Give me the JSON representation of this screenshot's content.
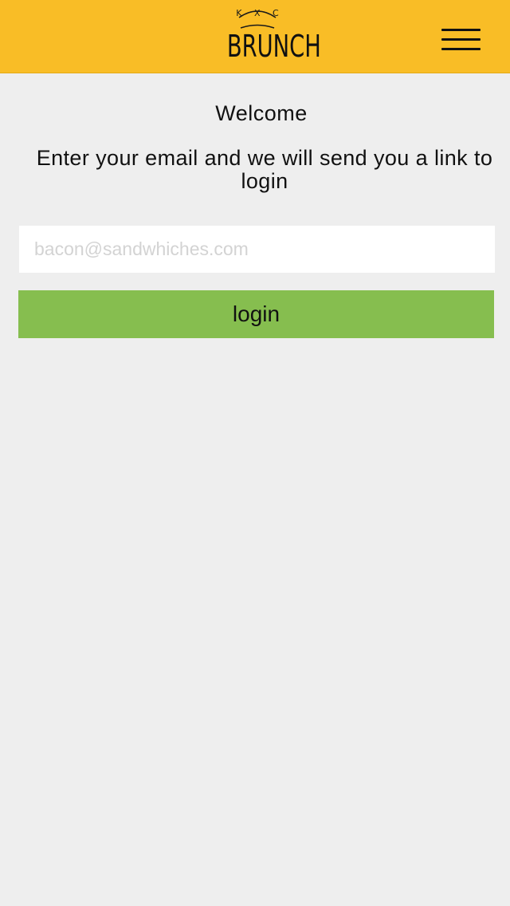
{
  "header": {
    "logo": {
      "top_text": "K X C",
      "main_text": "BRUNCH"
    },
    "menu_icon": "hamburger-menu-icon"
  },
  "main": {
    "welcome": "Welcome",
    "instructions": "Enter your email and we will send you a link to login",
    "email_placeholder": "bacon@sandwhiches.com",
    "email_value": "",
    "login_label": "login"
  },
  "colors": {
    "header_background": "#f9bd26",
    "page_background": "#eeeeee",
    "login_button": "#86be4f",
    "input_background": "#ffffff"
  }
}
